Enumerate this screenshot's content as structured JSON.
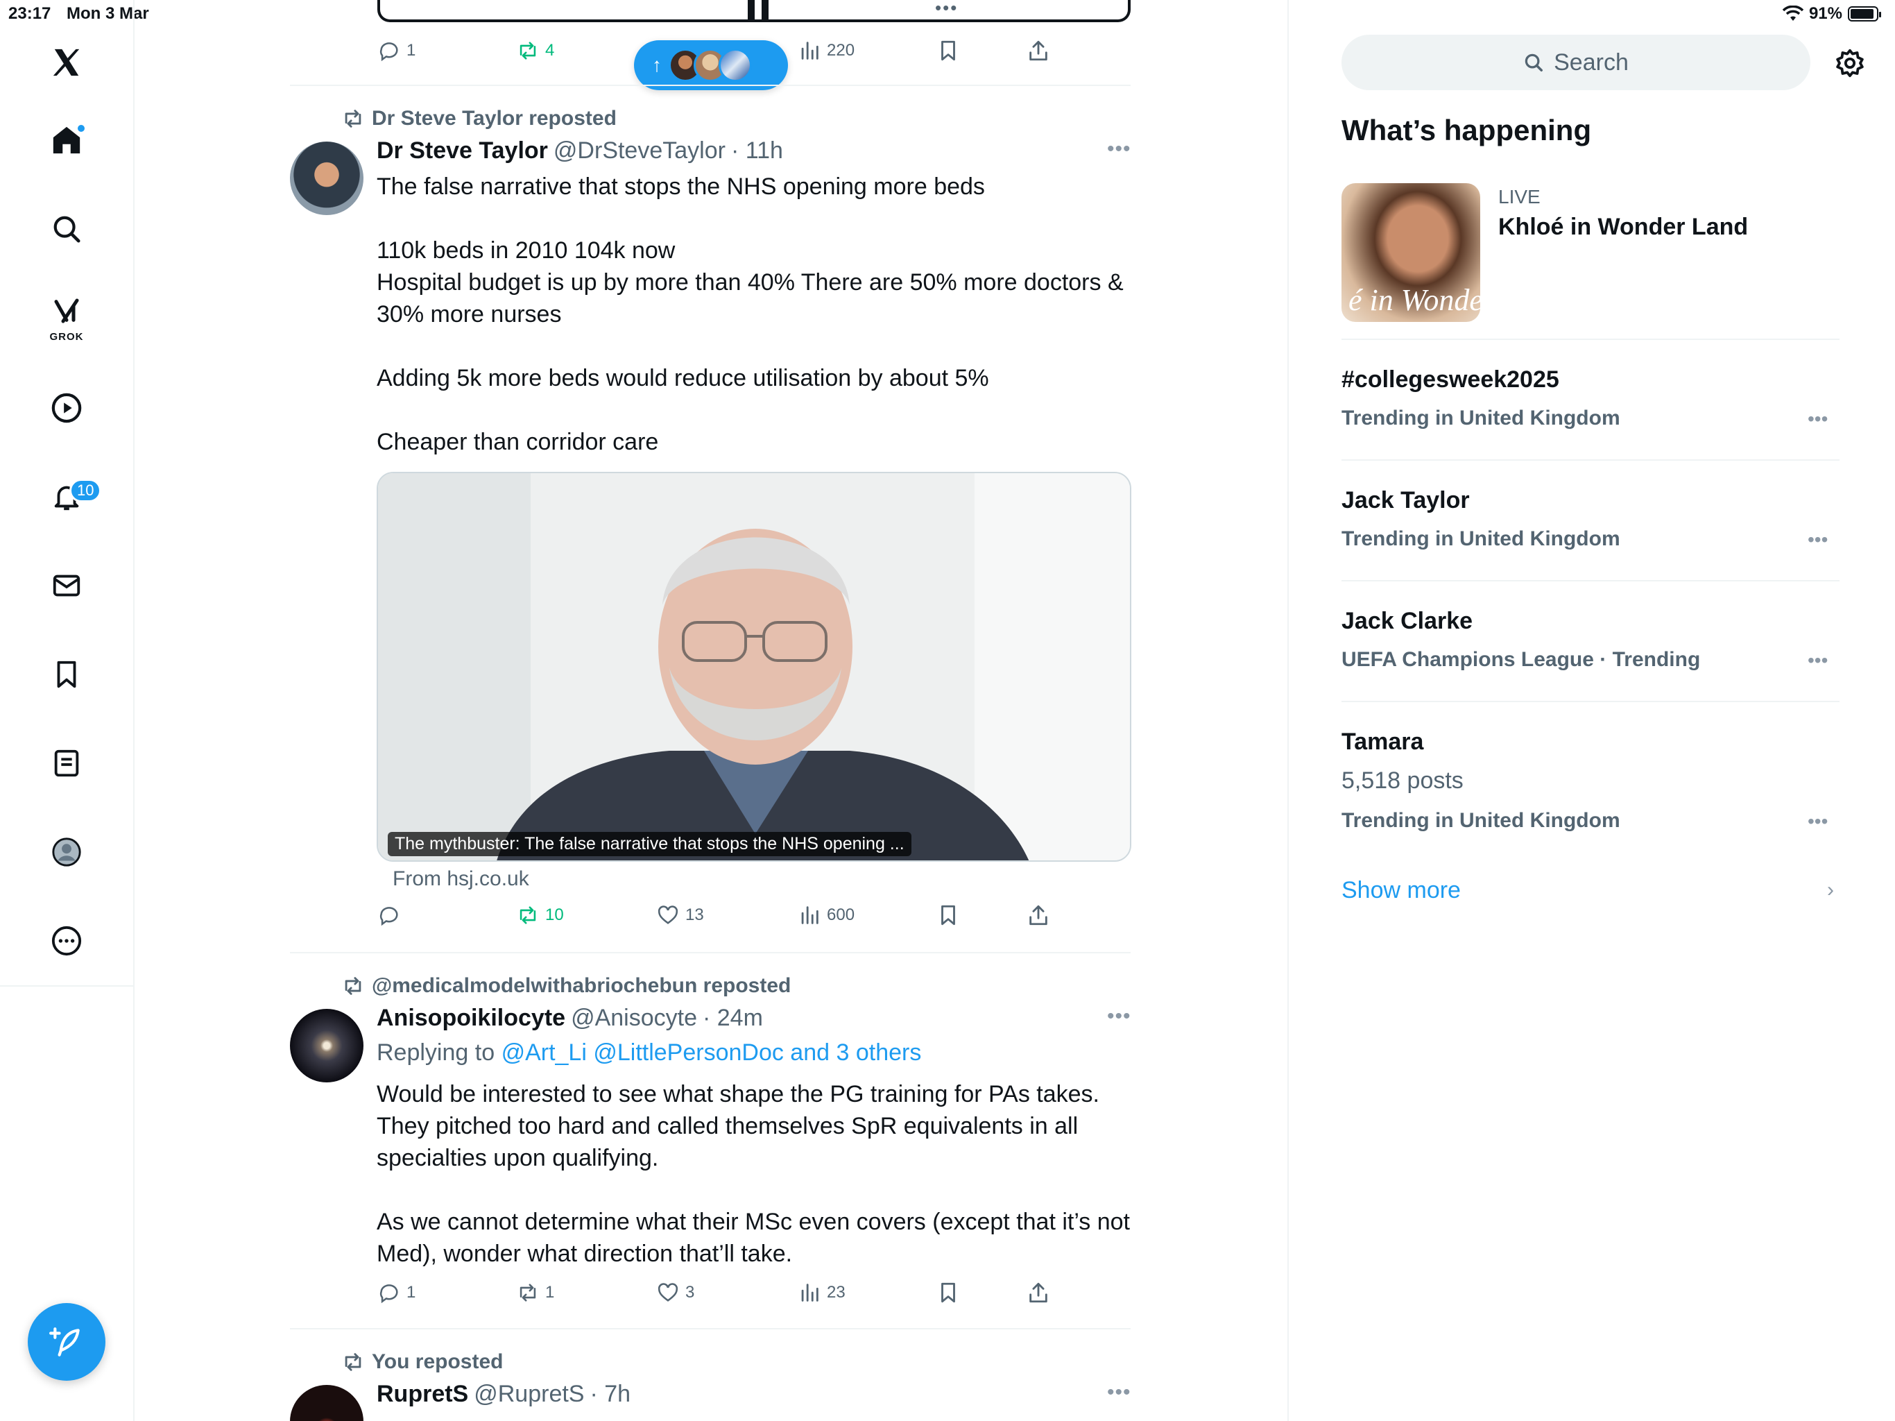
{
  "status_bar": {
    "time": "23:17",
    "date": "Mon 3 Mar",
    "battery": "91%",
    "battery_level": 0.91
  },
  "nav": {
    "grok_label": "GROK",
    "notifications_count": "10"
  },
  "new_posts_pill": {
    "arrow": "↑"
  },
  "top_tweet_actions": {
    "replies": "1",
    "reposts": "4",
    "views": "220"
  },
  "tweet1": {
    "repost_by": "Dr Steve Taylor reposted",
    "name": "Dr Steve Taylor",
    "handle": "@DrSteveTaylor",
    "time": "· 11h",
    "text": "The false narrative that stops the NHS opening more beds\n\n110k beds in 2010 104k now\nHospital budget is up by more than 40% There are 50% more doctors & 30% more nurses\n\nAdding 5k more beds would reduce utilisation by about 5%\n\nCheaper than corridor care",
    "card_caption": "The mythbuster: The false narrative that stops the NHS opening ...",
    "card_source": "From hsj.co.uk",
    "reposts": "10",
    "likes": "13",
    "views": "600"
  },
  "tweet2": {
    "repost_by": "@medicalmodelwithabriochebun reposted",
    "name": "Anisopoikilocyte",
    "handle": "@Anisocyte",
    "time": "· 24m",
    "replying_prefix": "Replying to",
    "replying_to": "@Art_Li @LittlePersonDoc and 3 others",
    "text": "Would be interested to see what shape the PG training for PAs takes. They pitched too hard and called themselves SpR equivalents in all specialties upon qualifying.\n\nAs we cannot determine what their MSc even covers (except that it’s not Med), wonder what direction that’ll take.",
    "replies": "1",
    "reposts": "1",
    "likes": "3",
    "views": "23"
  },
  "tweet3": {
    "repost_by": "You reposted",
    "name": "RupretS",
    "handle": "@RupretS",
    "time": "· 7h"
  },
  "sidebar": {
    "search_placeholder": "Search",
    "section_title": "What’s happening",
    "live": {
      "label": "LIVE",
      "title": "Khloé in Wonder Land",
      "thumb_text": "é in Wonder l"
    },
    "trends": [
      {
        "title": "#collegesweek2025",
        "sub": "Trending in United Kingdom"
      },
      {
        "title": "Jack Taylor",
        "sub": "Trending in United Kingdom"
      },
      {
        "title": "Jack Clarke",
        "sub": "UEFA Champions League · Trending"
      },
      {
        "title": "Tamara",
        "posts": "5,518 posts",
        "sub": "Trending in United Kingdom"
      }
    ],
    "show_more": "Show more"
  },
  "colors": {
    "accent": "#1d9bf0",
    "repost_green": "#00ba7c",
    "secondary_text": "#536471"
  }
}
